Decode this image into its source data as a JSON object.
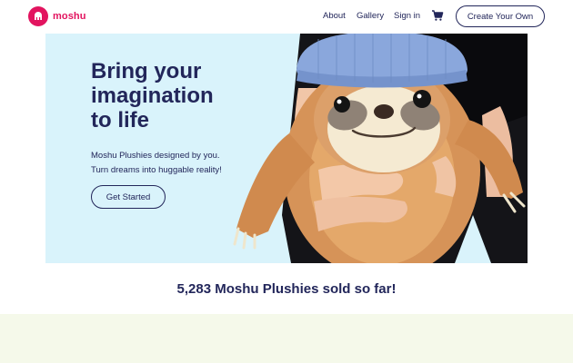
{
  "brand": {
    "name": "moshu",
    "logo_icon": "elephant-icon",
    "color": "#e2145f"
  },
  "nav": {
    "links": [
      "About",
      "Gallery",
      "Sign in"
    ],
    "cart_icon": "shopping-cart-icon",
    "cta": "Create Your Own"
  },
  "hero": {
    "title_lines": [
      "Bring your",
      "imagination",
      "to life"
    ],
    "subtitle_lines": [
      "Moshu Plushies designed by you.",
      "Turn dreams into huggable reality!"
    ],
    "button": "Get Started",
    "image": "person-hugging-sloth-plush-photo",
    "background": "#d9f3fb"
  },
  "stats": {
    "sold_text": "5,283 Moshu Plushies sold so far!"
  },
  "colors": {
    "text": "#22265a",
    "accent": "#e2145f",
    "band": "#f5f9ea"
  }
}
